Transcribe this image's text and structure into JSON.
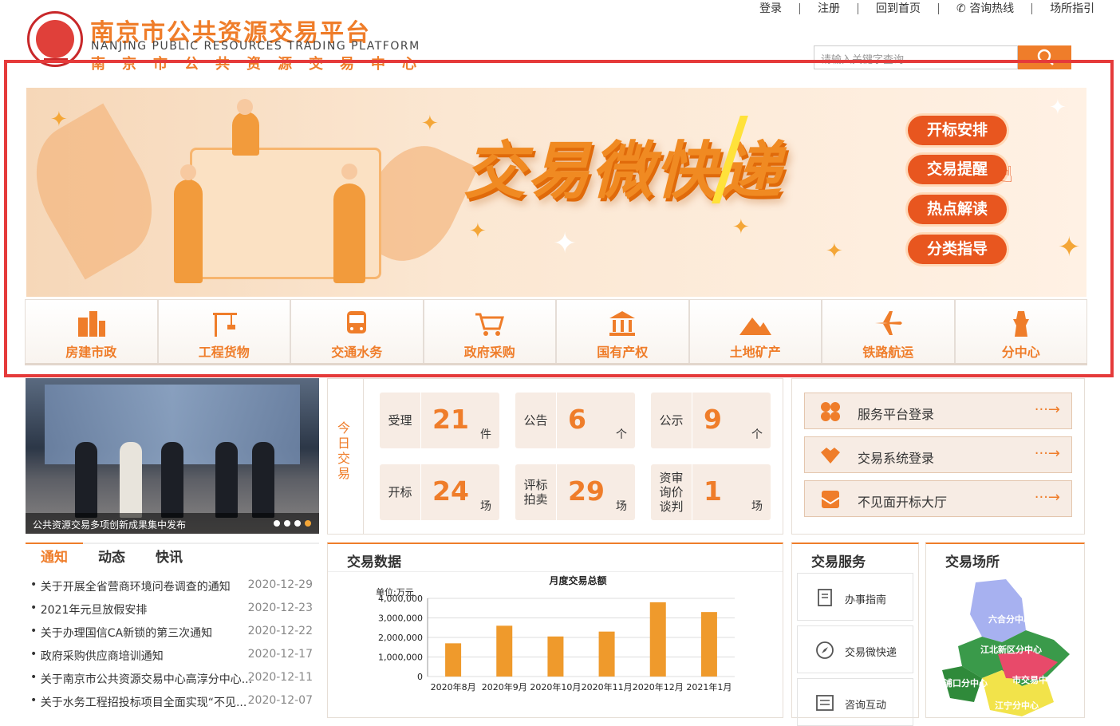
{
  "header": {
    "brand_cn": "南京市公共资源交易平台",
    "brand_en": "NANJING PUBLIC RESOURCES TRADING PLATFORM",
    "brand_sub": "南京市公共资源交易中心",
    "nav": [
      "登录",
      "注册",
      "回到首页",
      "咨询热线",
      "场所指引"
    ],
    "search_placeholder": "请输入关键字查询"
  },
  "banner": {
    "title": "交易微快递",
    "buttons": [
      "开标安排",
      "交易提醒",
      "热点解读",
      "分类指导"
    ]
  },
  "categories": [
    {
      "label": "房建市政",
      "icon": "building-icon"
    },
    {
      "label": "工程货物",
      "icon": "crane-icon"
    },
    {
      "label": "交通水务",
      "icon": "bus-icon"
    },
    {
      "label": "政府采购",
      "icon": "cart-icon"
    },
    {
      "label": "国有产权",
      "icon": "bank-icon"
    },
    {
      "label": "土地矿产",
      "icon": "mountain-icon"
    },
    {
      "label": "铁路航运",
      "icon": "plane-icon"
    },
    {
      "label": "分中心",
      "icon": "tower-icon"
    }
  ],
  "photo": {
    "caption": "公共资源交易多项创新成果集中发布"
  },
  "today": {
    "label": "今日交易",
    "stats": [
      {
        "label": "受理",
        "value": "21",
        "unit": "件"
      },
      {
        "label": "公告",
        "value": "6",
        "unit": "个"
      },
      {
        "label": "公示",
        "value": "9",
        "unit": "个"
      },
      {
        "label": "开标",
        "value": "24",
        "unit": "场"
      },
      {
        "label": "评标拍卖",
        "value": "29",
        "unit": "场"
      },
      {
        "label": "资审询价谈判",
        "value": "1",
        "unit": "场"
      }
    ]
  },
  "quick": [
    {
      "label": "服务平台登录",
      "icon": "clover-icon"
    },
    {
      "label": "交易系统登录",
      "icon": "handshake-icon"
    },
    {
      "label": "不见面开标大厅",
      "icon": "mail-icon"
    }
  ],
  "news": {
    "tabs": [
      "通知",
      "动态",
      "快讯"
    ],
    "items": [
      {
        "title": "关于开展全省营商环境问卷调查的通知",
        "date": "2020-12-29"
      },
      {
        "title": "2021年元旦放假安排",
        "date": "2020-12-23"
      },
      {
        "title": "关于办理国信CA新锁的第三次通知",
        "date": "2020-12-22"
      },
      {
        "title": "政府采购供应商培训通知",
        "date": "2020-12-17"
      },
      {
        "title": "关于南京市公共资源交易中心高淳分中心...",
        "date": "2020-12-11"
      },
      {
        "title": "关于水务工程招投标项目全面实现“不见...",
        "date": "2020-12-07"
      }
    ]
  },
  "trade_data": {
    "title": "交易数据"
  },
  "chart_data": {
    "type": "bar",
    "title": "月度交易总额",
    "ylabel": "单位:万元",
    "xlabel": "",
    "categories": [
      "2020年8月",
      "2020年9月",
      "2020年10月",
      "2020年11月",
      "2020年12月",
      "2021年1月"
    ],
    "values": [
      1700000,
      2600000,
      2050000,
      2300000,
      3800000,
      3300000
    ],
    "ylim": [
      0,
      4000000
    ],
    "yticks": [
      "4,000,000",
      "3,000,000",
      "2,000,000",
      "1,000,000",
      "0"
    ],
    "color": "#ef9a2c"
  },
  "services": {
    "title": "交易服务",
    "items": [
      {
        "label": "办事指南",
        "icon": "document-icon"
      },
      {
        "label": "交易微快递",
        "icon": "compass-icon"
      },
      {
        "label": "咨询互动",
        "icon": "chat-icon"
      }
    ]
  },
  "venues": {
    "title": "交易场所",
    "regions": [
      "六合分中心",
      "江北新区分中心",
      "浦口分中心",
      "市交易中心",
      "江宁分中心"
    ]
  }
}
